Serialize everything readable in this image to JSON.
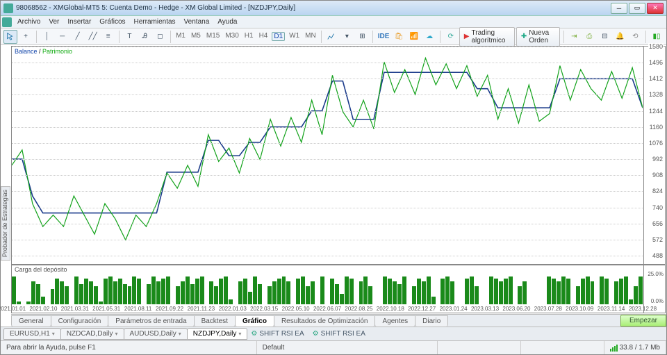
{
  "title": "98068562 - XMGlobal-MT5 5: Cuenta Demo - Hedge - XM Global Limited - [NZDJPY,Daily]",
  "menu": [
    "Archivo",
    "Ver",
    "Insertar",
    "Gráficos",
    "Herramientas",
    "Ventana",
    "Ayuda"
  ],
  "timeframes": [
    "M1",
    "M5",
    "M15",
    "M30",
    "H1",
    "H4",
    "D1",
    "W1",
    "MN"
  ],
  "active_timeframe": "D1",
  "algo_label": "Trading algorítmico",
  "order_label": "Nueva Orden",
  "legend_balance": "Balance",
  "legend_equity": "Patrimonio",
  "sub_legend": "Carga del depósito",
  "start_label": "Empezar",
  "tester_side": "Probador de Estrategias",
  "tabs": [
    "General",
    "Configuración",
    "Parámetros de entrada",
    "Backtest",
    "Gráfico",
    "Resultados de Optimización",
    "Agentes",
    "Diario"
  ],
  "active_tab": "Gráfico",
  "symbol_tabs": [
    "EURUSD,H1",
    "NZDCAD,Daily",
    "AUDUSD,Daily",
    "NZDJPY,Daily"
  ],
  "active_symbol_tab": "NZDJPY,Daily",
  "ea_tabs": [
    "SHIFT RSI EA",
    "SHIFT RSI EA"
  ],
  "status_help": "Para abrir la Ayuda, pulse F1",
  "status_center": "Default",
  "status_net": "33.8 / 1.7 Mb",
  "sub_y_top": "25.0%",
  "sub_y_bot": "0.0%",
  "chart_data": {
    "type": "line",
    "title": "",
    "xlabel": "",
    "ylabel": "",
    "ylim": [
      488,
      1580
    ],
    "y_ticks": [
      488,
      572,
      656,
      740,
      824,
      908,
      992,
      1076,
      1160,
      1244,
      1328,
      1412,
      1496,
      1580
    ],
    "x_ticks": [
      "2021.01.01",
      "2021.02.10",
      "2021.03.31",
      "2021.05.31",
      "2021.08.11",
      "2021.09.22",
      "2021.11.23",
      "2022.01.03",
      "2022.03.15",
      "2022.05.10",
      "2022.06.07",
      "2022.08.25",
      "2022.10.18",
      "2022.12.27",
      "2023.01.24",
      "2023.03.13",
      "2023.06.20",
      "2023.07.28",
      "2023.10.09",
      "2023.11.14",
      "2023.12.28"
    ],
    "series": [
      {
        "name": "Balance",
        "color": "#1a3a8a",
        "values": [
          992,
          992,
          800,
          711,
          711,
          711,
          711,
          711,
          711,
          711,
          711,
          711,
          711,
          711,
          711,
          924,
          924,
          924,
          924,
          1090,
          1090,
          1010,
          1010,
          1080,
          1080,
          1160,
          1160,
          1160,
          1160,
          1244,
          1244,
          1400,
          1400,
          1200,
          1200,
          1200,
          1445,
          1445,
          1445,
          1445,
          1445,
          1445,
          1445,
          1445,
          1445,
          1360,
          1360,
          1260,
          1260,
          1260,
          1260,
          1260,
          1260,
          1412,
          1412,
          1412,
          1412,
          1412,
          1412,
          1412,
          1412,
          1260
        ]
      },
      {
        "name": "Patrimonio",
        "color": "#12a21a",
        "values": [
          960,
          1040,
          760,
          640,
          700,
          640,
          800,
          700,
          600,
          760,
          680,
          570,
          700,
          640,
          760,
          920,
          840,
          960,
          850,
          1120,
          980,
          1050,
          920,
          1100,
          990,
          1200,
          1060,
          1210,
          1080,
          1300,
          1120,
          1430,
          1240,
          1160,
          1300,
          1150,
          1500,
          1340,
          1460,
          1330,
          1520,
          1380,
          1490,
          1360,
          1480,
          1320,
          1430,
          1200,
          1360,
          1180,
          1380,
          1190,
          1230,
          1480,
          1300,
          1460,
          1360,
          1300,
          1450,
          1310,
          1470,
          1260
        ]
      }
    ],
    "sub_bars": [
      22,
      2,
      0,
      2,
      18,
      16,
      6,
      0,
      12,
      20,
      18,
      14,
      0,
      22,
      16,
      20,
      18,
      14,
      2,
      20,
      22,
      18,
      20,
      16,
      14,
      22,
      20,
      0,
      16,
      22,
      18,
      20,
      22,
      0,
      14,
      18,
      22,
      16,
      20,
      22,
      0,
      18,
      14,
      20,
      22,
      4,
      0,
      18,
      20,
      10,
      22,
      16,
      0,
      14,
      18,
      20,
      22,
      18,
      0,
      20,
      22,
      14,
      18,
      0,
      22,
      0,
      20,
      16,
      8,
      22,
      20,
      0,
      18,
      22,
      14,
      0,
      0,
      22,
      20,
      18,
      16,
      22,
      0,
      14,
      20,
      18,
      22,
      6,
      0,
      20,
      22,
      18,
      0,
      0,
      20,
      22,
      14,
      0,
      0,
      22,
      20,
      18,
      20,
      22,
      0,
      14,
      18,
      0,
      0,
      0,
      0,
      22,
      20,
      18,
      22,
      20,
      0,
      14,
      20,
      22,
      18,
      0,
      22,
      20,
      0,
      18,
      20,
      22,
      4,
      14,
      22
    ]
  }
}
